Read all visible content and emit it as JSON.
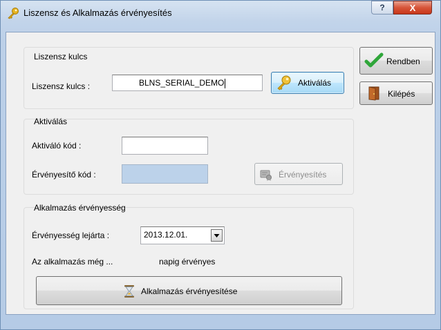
{
  "window": {
    "title": "Liszensz és Alkalmazás érvényesítés",
    "help_label": "?",
    "close_label": "X"
  },
  "license_group": {
    "title": "Liszensz kulcs",
    "key_label": "Liszensz kulcs :",
    "key_value": "BLNS_SERIAL_DEMO",
    "activate_button": "Aktiválás"
  },
  "activation_group": {
    "title": "Aktiválás",
    "activator_code_label": "Aktiváló kód :",
    "activator_code_value": "",
    "validation_code_label": "Érvényesítő kód :",
    "validation_code_value": "",
    "validate_button": "Érvényesítés"
  },
  "validity_group": {
    "title": "Alkalmazás érvényesség",
    "expiry_label": "Érvényesség lejárta :",
    "expiry_value": "2013.12.01.",
    "remaining_prefix": "Az alkalmazás még ...",
    "remaining_suffix": "napig érvényes",
    "validate_app_button": "Alkalmazás érvényesítése"
  },
  "side_buttons": {
    "ok_label": "Rendben",
    "exit_label": "Kilépés"
  },
  "colors": {
    "accent_check": "#2fa63a",
    "key_gold": "#e0a810",
    "close_red": "#c8371a"
  },
  "icons": {
    "title": "key-icon",
    "activate": "key-icon",
    "validate": "cert-icon",
    "ok": "checkmark-icon",
    "exit": "door-icon",
    "validate_app": "hourglass-icon",
    "dropdown": "chevron-down-icon"
  }
}
